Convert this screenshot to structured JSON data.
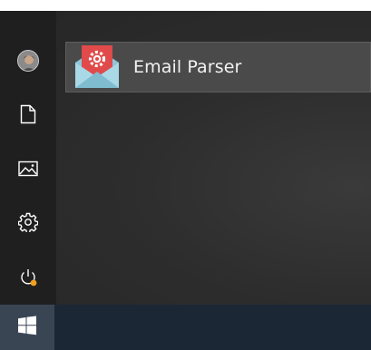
{
  "start_menu": {
    "rail": {
      "items": [
        {
          "name": "user-account",
          "icon": "avatar-icon"
        },
        {
          "name": "documents",
          "icon": "document-icon"
        },
        {
          "name": "pictures",
          "icon": "picture-icon"
        },
        {
          "name": "settings",
          "icon": "gear-icon"
        },
        {
          "name": "power",
          "icon": "power-icon",
          "badge_color": "#f0a020"
        }
      ]
    },
    "pinned_app": {
      "label": "Email Parser",
      "icon": "email-parser-icon"
    }
  },
  "taskbar": {
    "start_icon": "windows-logo-icon"
  },
  "colors": {
    "menu_bg": "#2c2c2c",
    "rail_bg": "#1f1f1f",
    "tile_bg": "#4a4a4a",
    "taskbar_bg": "#1c2735",
    "start_bg": "#3a4554",
    "power_badge": "#f0a020"
  }
}
